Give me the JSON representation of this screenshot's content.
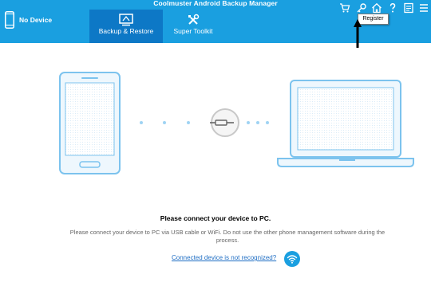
{
  "app": {
    "title": "Coolmuster Android Backup Manager"
  },
  "device": {
    "label": "No Device",
    "icon": "phone-icon"
  },
  "tabs": [
    {
      "label": "Backup & Restore",
      "icon": "backup-restore-icon",
      "active": true
    },
    {
      "label": "Super Toolkit",
      "icon": "toolkit-icon",
      "active": false
    }
  ],
  "top_icons": [
    "cart-icon",
    "key-icon",
    "home-icon",
    "help-icon",
    "feedback-icon",
    "menu-icon"
  ],
  "tooltip": {
    "text": "Register"
  },
  "main": {
    "title": "Please connect your device to PC.",
    "description": "Please connect your device to PC via USB cable or WiFi. Do not use the other phone management software during the process.",
    "link": "Connected device is not recognized?"
  },
  "colors": {
    "header": "#1a9fe0",
    "active_tab": "#0d78c6",
    "accent": "#1a9fe0",
    "link": "#1f6ec4"
  }
}
